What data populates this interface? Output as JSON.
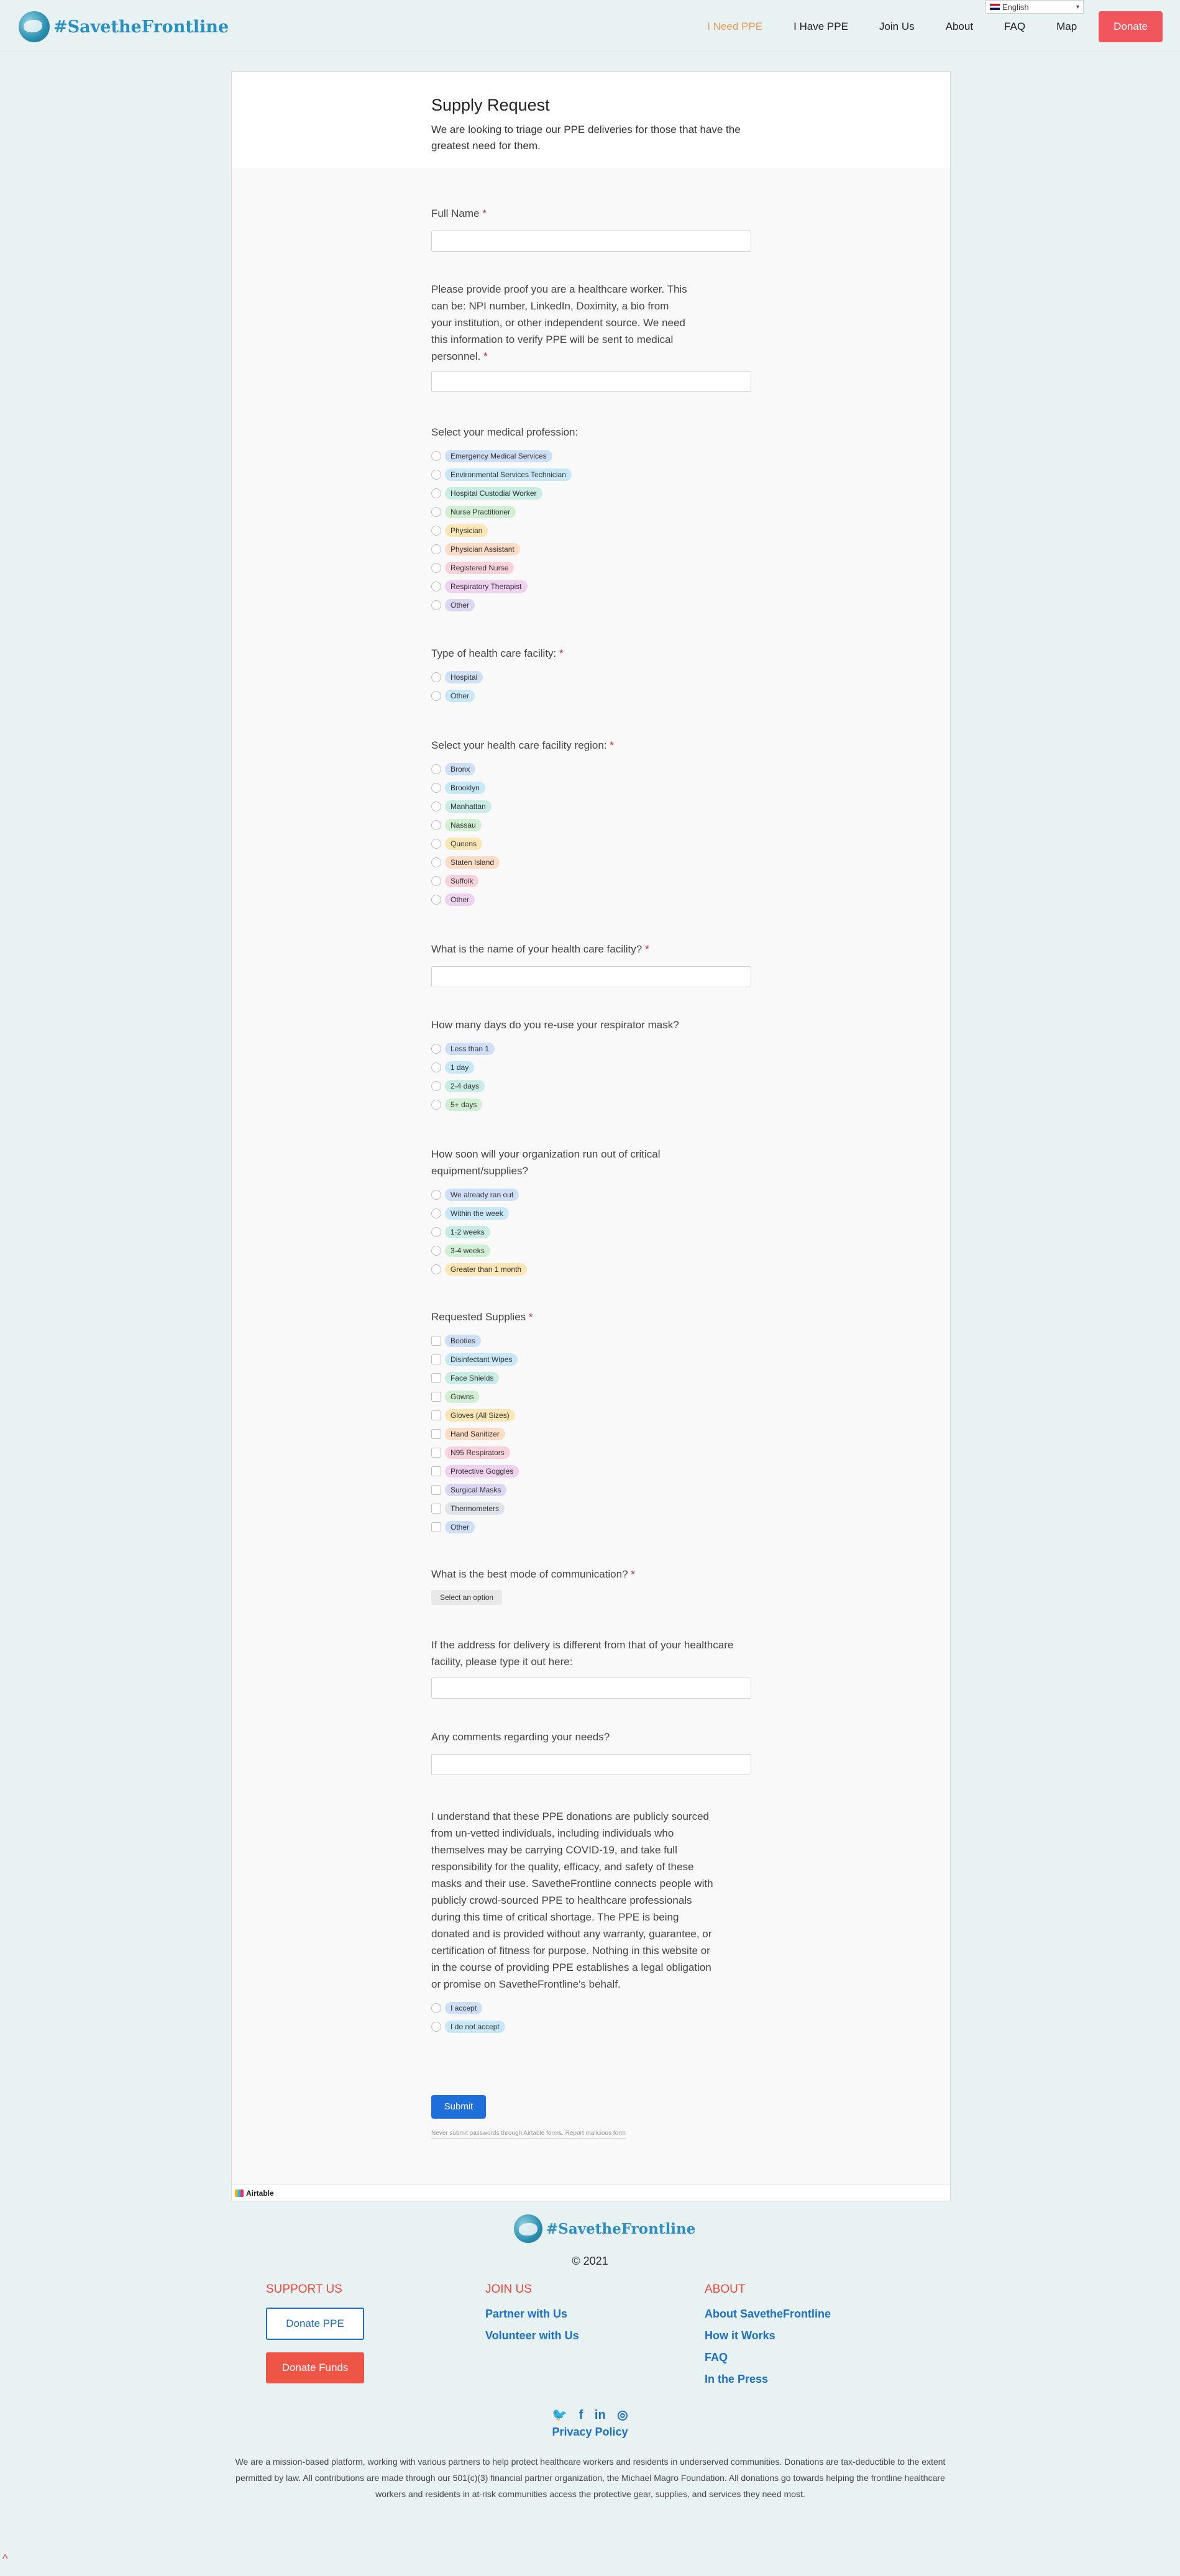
{
  "header": {
    "logo_text": "#SavetheFrontline",
    "nav": [
      "I Need PPE",
      "I Have PPE",
      "Join Us",
      "About",
      "FAQ",
      "Map"
    ],
    "donate": "Donate",
    "language": "English"
  },
  "form": {
    "title": "Supply Request",
    "description": "We are looking to triage our PPE deliveries for those that have the greatest need for them.",
    "full_name_label": "Full Name",
    "proof_label": "Please provide proof you are a healthcare worker. This can be: NPI number, LinkedIn, Doximity, a bio from your institution, or other independent source. We need this information to verify PPE will be sent to medical personnel.",
    "profession_label": "Select your medical profession:",
    "professions": [
      "Emergency Medical Services",
      "Environmental Services Technician",
      "Hospital Custodial Worker",
      "Nurse Practitioner",
      "Physician",
      "Physician Assistant",
      "Registered Nurse",
      "Respiratory Therapist",
      "Other"
    ],
    "facility_type_label": "Type of health care facility:",
    "facility_types": [
      "Hospital",
      "Other"
    ],
    "region_label": "Select your health care facility region:",
    "regions": [
      "Bronx",
      "Brooklyn",
      "Manhattan",
      "Nassau",
      "Queens",
      "Staten Island",
      "Suffolk",
      "Other"
    ],
    "facility_name_label": "What is the name of your health care facility?",
    "reuse_label": "How many days do you re-use your respirator mask?",
    "reuse_options": [
      "Less than 1",
      "1 day",
      "2-4 days",
      "5+ days"
    ],
    "runout_label": "How soon will your organization run out of critical equipment/supplies?",
    "runout_options": [
      "We already ran out",
      "Within the week",
      "1-2 weeks",
      "3-4 weeks",
      "Greater than 1 month"
    ],
    "supplies_label": "Requested Supplies",
    "supplies": [
      "Booties",
      "Disinfectant Wipes",
      "Face Shields",
      "Gowns",
      "Gloves (All Sizes)",
      "Hand Sanitizer",
      "N95 Respirators",
      "Protective Goggles",
      "Surgical Masks",
      "Thermometers",
      "Other"
    ],
    "communication_label": "What is the best mode of communication?",
    "communication_select": "Select an option",
    "address_label": "If the address for delivery is different from that of your healthcare facility, please type it out here:",
    "comments_label": "Any comments regarding your needs?",
    "disclaimer": "I understand that these PPE donations are publicly sourced from un-vetted individuals, including individuals who themselves may be carrying COVID-19, and take full responsibility for the quality, efficacy, and safety of these masks and their use. SavetheFrontline connects people with publicly crowd-sourced PPE to healthcare professionals during this time of critical shortage. The PPE is being donated and is provided without any warranty, guarantee, or certification of fitness for purpose. Nothing in this website or in the course of providing PPE establishes a legal obligation or promise on SavetheFrontline's behalf.",
    "accept_options": [
      "I accept",
      "I do not accept"
    ],
    "required_mark": "*",
    "submit": "Submit",
    "fineprint": "Never submit passwords through Airtable forms. Report malicious form",
    "airtable": "Airtable"
  },
  "footer": {
    "logo_text": "#SavetheFrontline",
    "copyright": "© 2021",
    "support_heading": "SUPPORT US",
    "donate_ppe": "Donate PPE",
    "donate_funds": "Donate Funds",
    "join_heading": "JOIN US",
    "join_links": [
      "Partner with Us",
      "Volunteer with Us"
    ],
    "about_heading": "ABOUT",
    "about_links": [
      "About SavetheFrontline",
      "How it Works",
      "FAQ",
      "In the Press"
    ],
    "privacy": "Privacy Policy",
    "about_text": "We are a mission-based platform, working with various partners to help protect healthcare workers and residents in underserved communities. Donations are tax-deductible to the extent permitted by law. All contributions are made through our 501(c)(3) financial partner organization, the Michael Magro Foundation. All donations go towards helping the frontline healthcare workers and residents in at-risk communities access the protective gear, supplies, and services they need most."
  },
  "colors": {
    "accent_orange": "#e89b55",
    "donate_red": "#f0565c",
    "link_blue": "#1a6fc9",
    "submit_blue": "#1e6fd9",
    "heading_red": "#e8473b",
    "pill_palette": [
      "#cfdff5",
      "#c9e8f7",
      "#c9ede6",
      "#d1efd2",
      "#fbe7b5",
      "#fbdcc6",
      "#f9d3dc",
      "#efd1f0",
      "#dcd6f2",
      "#dfe3ea"
    ]
  }
}
